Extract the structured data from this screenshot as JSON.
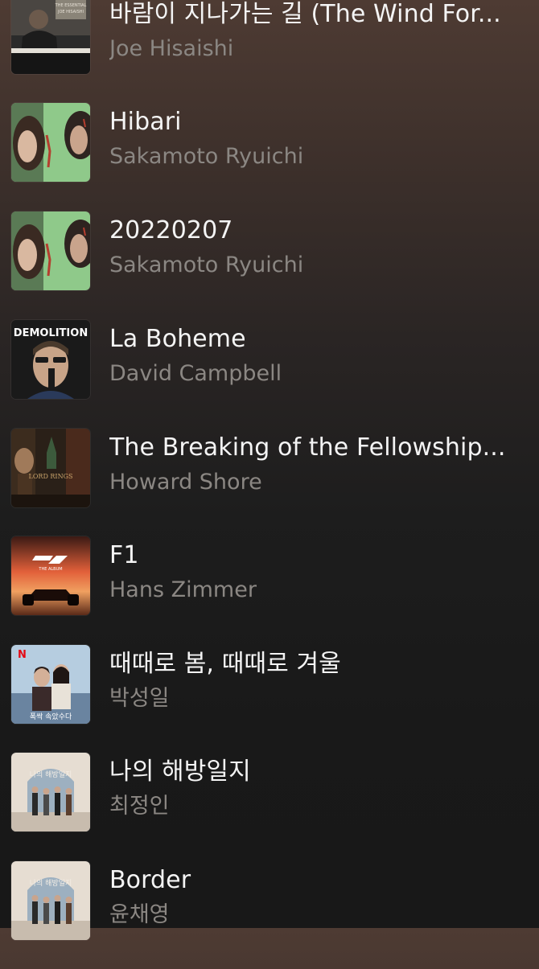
{
  "songs": [
    {
      "title": "바람이 지나가는 길 (The Wind For...",
      "artist": "Joe Hisaishi",
      "artwork_icon": "piano-album-art",
      "artwork_palette": [
        "#3a3a3a",
        "#d8d0c0"
      ]
    },
    {
      "title": "Hibari",
      "artist": "Sakamoto Ryuichi",
      "artwork_icon": "face-green-album-art",
      "artwork_palette": [
        "#7dbf7a",
        "#b43e2e"
      ]
    },
    {
      "title": "20220207",
      "artist": "Sakamoto Ryuichi",
      "artwork_icon": "face-green-album-art",
      "artwork_palette": [
        "#7dbf7a",
        "#b43e2e"
      ]
    },
    {
      "title": "La Boheme",
      "artist": "David Campbell",
      "artwork_icon": "demolition-album-art",
      "artwork_text": "DEMOLITION",
      "artwork_palette": [
        "#1c1c1c",
        "#ffffff"
      ]
    },
    {
      "title": "The Breaking of the Fellowship...",
      "artist": "Howard Shore",
      "artwork_icon": "lotr-album-art",
      "artwork_text": "LORD RINGS",
      "artwork_palette": [
        "#3a2a1c",
        "#c9a36a"
      ]
    },
    {
      "title": "F1",
      "artist": "Hans Zimmer",
      "artwork_icon": "f1-album-art",
      "artwork_text": "THE ALBUM",
      "artwork_palette": [
        "#e2603a",
        "#2a1210"
      ]
    },
    {
      "title": "때때로 봄, 때때로 겨울",
      "artist": "박성일",
      "artwork_icon": "netflix-drama-album-art",
      "artwork_text": "폭싹 속았수다",
      "artwork_palette": [
        "#a8c2d6",
        "#e50914"
      ]
    },
    {
      "title": "나의 해방일지",
      "artist": "최정인",
      "artwork_icon": "drama-arch-album-art",
      "artwork_text": "나의 해방일지",
      "artwork_palette": [
        "#dcd2c6",
        "#8a9eaf"
      ]
    },
    {
      "title": "Border",
      "artist": "윤채영",
      "artwork_icon": "drama-arch-album-art",
      "artwork_text": "나의 해방일지",
      "artwork_palette": [
        "#dcd2c6",
        "#8a9eaf"
      ]
    }
  ]
}
